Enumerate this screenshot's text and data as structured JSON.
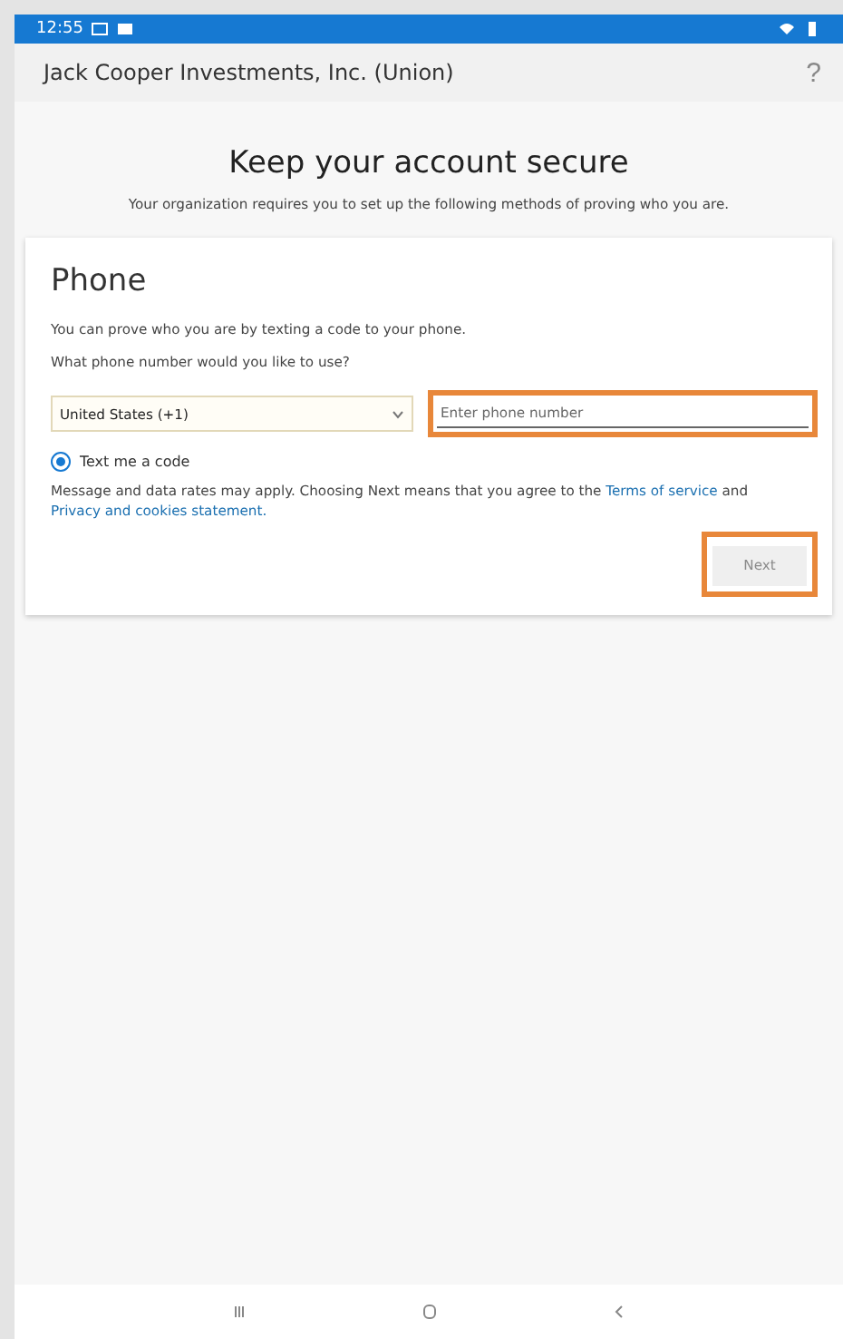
{
  "status_bar": {
    "time": "12:55"
  },
  "app_bar": {
    "title": "Jack Cooper Investments, Inc. (Union)",
    "help": "?"
  },
  "heading": "Keep your account secure",
  "subheading": "Your organization requires you to set up the following methods of proving who you are.",
  "card": {
    "title": "Phone",
    "intro": "You can prove who you are by texting a code to your phone.",
    "question": "What phone number would you like to use?",
    "country": {
      "value": "United States (+1)"
    },
    "phone": {
      "placeholder": "Enter phone number",
      "highlighted": true
    },
    "options": [
      {
        "label": "Text me a code",
        "selected": true
      }
    ],
    "notice": "Message and data rates may apply. Choosing Next means that you agree to the ",
    "links": [
      "Terms of service",
      "Privacy and cookies statement."
    ],
    "notice_joiner": " and ",
    "next": {
      "label": "Next",
      "disabled": true,
      "highlighted": true
    }
  }
}
